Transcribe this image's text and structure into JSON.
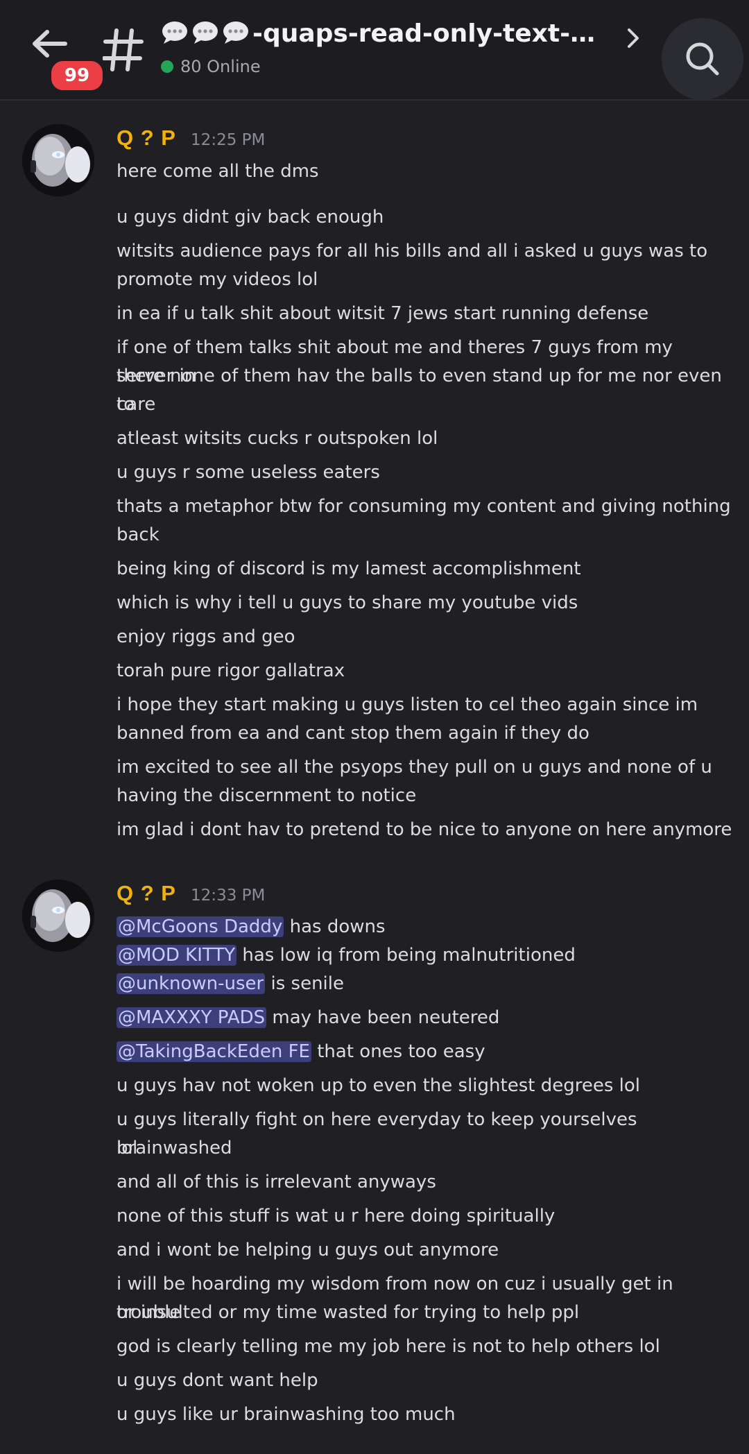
{
  "header": {
    "unread_count": "99",
    "channel_name": "-quaps-read-only-text-",
    "online_text": "80 Online"
  },
  "messages": [
    {
      "username": "Q ? P",
      "timestamp": "12:25 PM",
      "lines": [
        "here come all the dms",
        "u guys didnt giv back enough",
        "witsits audience pays for all his bills and all i asked u guys was to",
        "promote my videos lol",
        "in ea if u talk shit about witsit 7 jews start running defense",
        "if one of them talks shit about me and theres 7 guys from my server in",
        "there none of them hav the balls to even stand up for me nor even care",
        "to",
        "atleast witsits cucks r outspoken lol",
        "u guys r some useless eaters",
        "thats a metaphor btw for consuming my content and giving nothing",
        "back",
        "being king of discord is my lamest accomplishment",
        "which is why i tell u guys to share my youtube vids",
        "enjoy riggs and geo",
        "torah pure rigor gallatrax",
        "i hope they start making u guys listen to cel theo again since im",
        "banned from ea and cant stop them again if they do",
        "im excited to see all the psyops they pull on u guys and none of u",
        "having the discernment to notice",
        "im glad i dont hav to pretend to be nice to anyone on here anymore"
      ]
    },
    {
      "username": "Q ? P",
      "timestamp": "12:33 PM",
      "mention_lines": [
        {
          "mention": "@McGoons Daddy",
          "text": " has downs"
        },
        {
          "mention": "@MOD KITTY",
          "text": " has low iq from being malnutritioned"
        },
        {
          "mention": "@unknown-user",
          "text": " is senile"
        },
        {
          "mention": "@MAXXXY PADS",
          "text": " may have been neutered"
        },
        {
          "mention": "@TakingBackEden FE",
          "text": " that ones too easy"
        }
      ],
      "lines": [
        "u guys hav not woken up to even the slightest degrees lol",
        "u guys literally fight on here everyday to keep yourselves brainwashed",
        "lol",
        "and all of this is irrelevant anyways",
        "none of this stuff is wat u r here doing spiritually",
        "and i wont be helping u guys out anymore",
        "i will be hoarding my wisdom from now on cuz i usually get in trouble",
        "or insulted or my time wasted for trying to help ppl",
        "god is clearly telling me my job here is not to help others lol",
        "u guys dont want help",
        "u guys like ur brainwashing too much"
      ]
    }
  ]
}
